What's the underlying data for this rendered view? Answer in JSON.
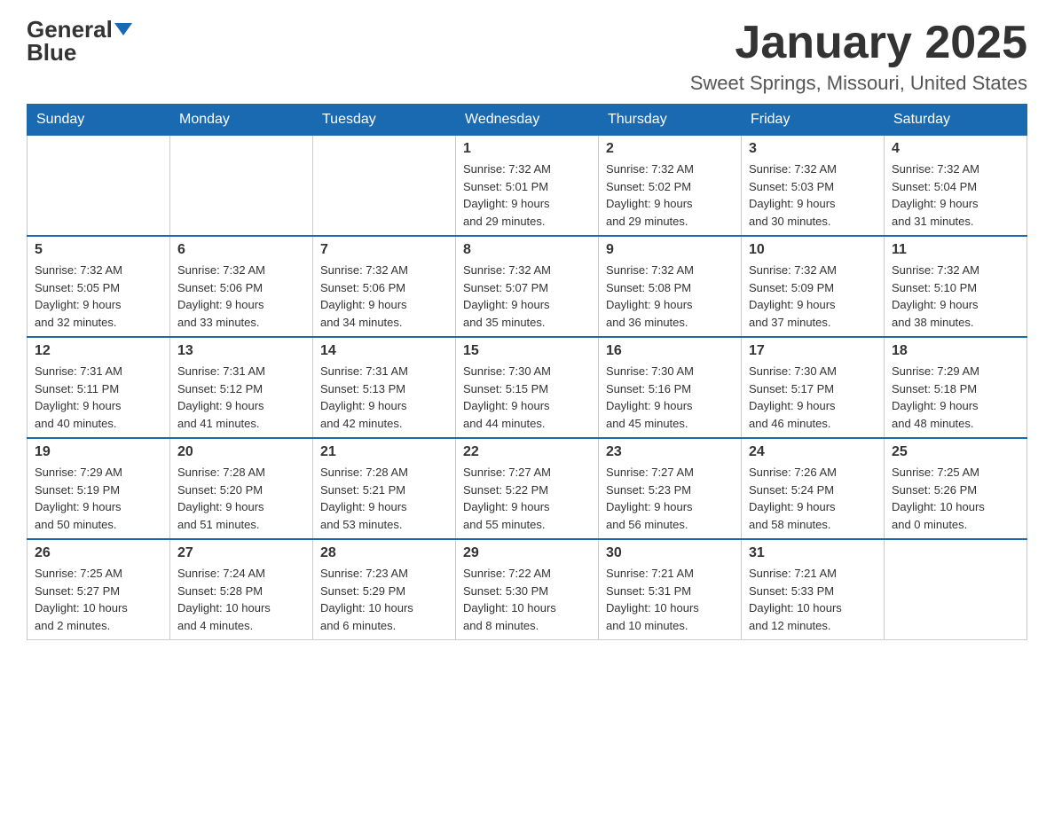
{
  "header": {
    "logo_general": "General",
    "logo_blue": "Blue",
    "month_title": "January 2025",
    "location": "Sweet Springs, Missouri, United States"
  },
  "days_of_week": [
    "Sunday",
    "Monday",
    "Tuesday",
    "Wednesday",
    "Thursday",
    "Friday",
    "Saturday"
  ],
  "weeks": [
    [
      {
        "day": "",
        "info": ""
      },
      {
        "day": "",
        "info": ""
      },
      {
        "day": "",
        "info": ""
      },
      {
        "day": "1",
        "info": "Sunrise: 7:32 AM\nSunset: 5:01 PM\nDaylight: 9 hours\nand 29 minutes."
      },
      {
        "day": "2",
        "info": "Sunrise: 7:32 AM\nSunset: 5:02 PM\nDaylight: 9 hours\nand 29 minutes."
      },
      {
        "day": "3",
        "info": "Sunrise: 7:32 AM\nSunset: 5:03 PM\nDaylight: 9 hours\nand 30 minutes."
      },
      {
        "day": "4",
        "info": "Sunrise: 7:32 AM\nSunset: 5:04 PM\nDaylight: 9 hours\nand 31 minutes."
      }
    ],
    [
      {
        "day": "5",
        "info": "Sunrise: 7:32 AM\nSunset: 5:05 PM\nDaylight: 9 hours\nand 32 minutes."
      },
      {
        "day": "6",
        "info": "Sunrise: 7:32 AM\nSunset: 5:06 PM\nDaylight: 9 hours\nand 33 minutes."
      },
      {
        "day": "7",
        "info": "Sunrise: 7:32 AM\nSunset: 5:06 PM\nDaylight: 9 hours\nand 34 minutes."
      },
      {
        "day": "8",
        "info": "Sunrise: 7:32 AM\nSunset: 5:07 PM\nDaylight: 9 hours\nand 35 minutes."
      },
      {
        "day": "9",
        "info": "Sunrise: 7:32 AM\nSunset: 5:08 PM\nDaylight: 9 hours\nand 36 minutes."
      },
      {
        "day": "10",
        "info": "Sunrise: 7:32 AM\nSunset: 5:09 PM\nDaylight: 9 hours\nand 37 minutes."
      },
      {
        "day": "11",
        "info": "Sunrise: 7:32 AM\nSunset: 5:10 PM\nDaylight: 9 hours\nand 38 minutes."
      }
    ],
    [
      {
        "day": "12",
        "info": "Sunrise: 7:31 AM\nSunset: 5:11 PM\nDaylight: 9 hours\nand 40 minutes."
      },
      {
        "day": "13",
        "info": "Sunrise: 7:31 AM\nSunset: 5:12 PM\nDaylight: 9 hours\nand 41 minutes."
      },
      {
        "day": "14",
        "info": "Sunrise: 7:31 AM\nSunset: 5:13 PM\nDaylight: 9 hours\nand 42 minutes."
      },
      {
        "day": "15",
        "info": "Sunrise: 7:30 AM\nSunset: 5:15 PM\nDaylight: 9 hours\nand 44 minutes."
      },
      {
        "day": "16",
        "info": "Sunrise: 7:30 AM\nSunset: 5:16 PM\nDaylight: 9 hours\nand 45 minutes."
      },
      {
        "day": "17",
        "info": "Sunrise: 7:30 AM\nSunset: 5:17 PM\nDaylight: 9 hours\nand 46 minutes."
      },
      {
        "day": "18",
        "info": "Sunrise: 7:29 AM\nSunset: 5:18 PM\nDaylight: 9 hours\nand 48 minutes."
      }
    ],
    [
      {
        "day": "19",
        "info": "Sunrise: 7:29 AM\nSunset: 5:19 PM\nDaylight: 9 hours\nand 50 minutes."
      },
      {
        "day": "20",
        "info": "Sunrise: 7:28 AM\nSunset: 5:20 PM\nDaylight: 9 hours\nand 51 minutes."
      },
      {
        "day": "21",
        "info": "Sunrise: 7:28 AM\nSunset: 5:21 PM\nDaylight: 9 hours\nand 53 minutes."
      },
      {
        "day": "22",
        "info": "Sunrise: 7:27 AM\nSunset: 5:22 PM\nDaylight: 9 hours\nand 55 minutes."
      },
      {
        "day": "23",
        "info": "Sunrise: 7:27 AM\nSunset: 5:23 PM\nDaylight: 9 hours\nand 56 minutes."
      },
      {
        "day": "24",
        "info": "Sunrise: 7:26 AM\nSunset: 5:24 PM\nDaylight: 9 hours\nand 58 minutes."
      },
      {
        "day": "25",
        "info": "Sunrise: 7:25 AM\nSunset: 5:26 PM\nDaylight: 10 hours\nand 0 minutes."
      }
    ],
    [
      {
        "day": "26",
        "info": "Sunrise: 7:25 AM\nSunset: 5:27 PM\nDaylight: 10 hours\nand 2 minutes."
      },
      {
        "day": "27",
        "info": "Sunrise: 7:24 AM\nSunset: 5:28 PM\nDaylight: 10 hours\nand 4 minutes."
      },
      {
        "day": "28",
        "info": "Sunrise: 7:23 AM\nSunset: 5:29 PM\nDaylight: 10 hours\nand 6 minutes."
      },
      {
        "day": "29",
        "info": "Sunrise: 7:22 AM\nSunset: 5:30 PM\nDaylight: 10 hours\nand 8 minutes."
      },
      {
        "day": "30",
        "info": "Sunrise: 7:21 AM\nSunset: 5:31 PM\nDaylight: 10 hours\nand 10 minutes."
      },
      {
        "day": "31",
        "info": "Sunrise: 7:21 AM\nSunset: 5:33 PM\nDaylight: 10 hours\nand 12 minutes."
      },
      {
        "day": "",
        "info": ""
      }
    ]
  ]
}
